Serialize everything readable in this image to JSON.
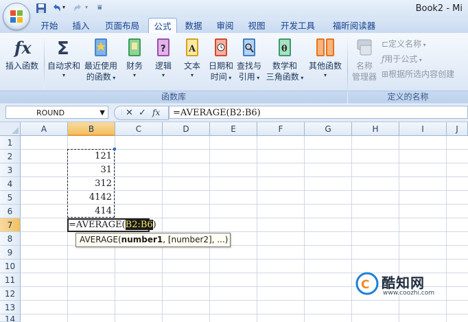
{
  "window": {
    "title": "Book2 - Mi"
  },
  "tabs": [
    "开始",
    "插入",
    "页面布局",
    "公式",
    "数据",
    "审阅",
    "视图",
    "开发工具",
    "福昕阅读器"
  ],
  "active_tab": "公式",
  "ribbon": {
    "insert_function": "插入函数",
    "autosum": "自动求和",
    "recent": [
      "最近使用",
      "的函数"
    ],
    "financial": "财务",
    "logical": "逻辑",
    "text": "文本",
    "datetime": [
      "日期和",
      "时间"
    ],
    "lookup": [
      "查找与",
      "引用"
    ],
    "math": [
      "数学和",
      "三角函数"
    ],
    "more": "其他函数",
    "library_caption": "函数库",
    "name_manager": [
      "名称",
      "管理器"
    ],
    "define_name": "定义名称",
    "use_in_formula": "用于公式",
    "create_from_selection": "根据所选内容创建",
    "defined_names_caption": "定义的名称"
  },
  "formula_bar": {
    "name_box": "ROUND",
    "fx": "fx",
    "formula": "=AVERAGE(B2:B6)"
  },
  "columns": [
    "A",
    "B",
    "C",
    "D",
    "E",
    "F",
    "G",
    "H",
    "I",
    "J"
  ],
  "rows": [
    "1",
    "2",
    "3",
    "4",
    "5",
    "6",
    "7",
    "8",
    "9",
    "10",
    "11",
    "12",
    "13",
    "14"
  ],
  "cells_b": [
    "121",
    "31",
    "312",
    "4142",
    "414"
  ],
  "edit_cell": {
    "prefix": "=AVERAGE(",
    "ref": "B2:B6",
    "suffix": ")"
  },
  "tooltip": {
    "func": "AVERAGE(",
    "arg1": "number1",
    "rest": ", [number2], ...)"
  },
  "watermark": {
    "brand": "酷知网",
    "url": "www.coozhi.com"
  }
}
